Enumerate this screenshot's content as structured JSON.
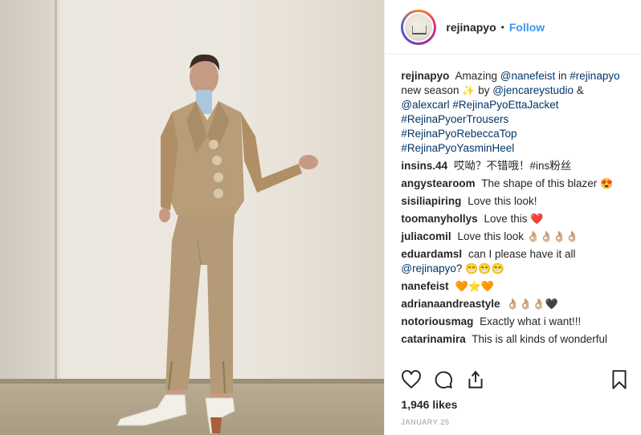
{
  "header": {
    "username": "rejinapyo",
    "separator": "•",
    "follow_label": "Follow"
  },
  "caption": {
    "username": "rejinapyo",
    "parts": [
      "Amazing",
      "@nanefeist",
      "in",
      "#rejinapyo",
      "new season",
      "✨",
      "by",
      "@jencareystudio",
      "&",
      "@alexcarl",
      "#RejinaPyoEttaJacket",
      "#RejinaPyoerTrousers",
      "#RejinaPyoRebeccaTop",
      "#RejinaPyoYasminHeel"
    ]
  },
  "comments": [
    {
      "user": "insins.44",
      "text": "哎呦？不错哦！#ins粉丝"
    },
    {
      "user": "angystearoom",
      "text": "The shape of this blazer",
      "emoji": "😍"
    },
    {
      "user": "sisiliapiring",
      "text": "Love this look!"
    },
    {
      "user": "toomanyhollys",
      "text": "Love this",
      "emoji": "❤️"
    },
    {
      "user": "juliacomil",
      "text": "Love this look",
      "emoji": "👌🏼👌🏼👌🏼👌🏼"
    },
    {
      "user": "eduardamsl",
      "text": "can I please have it all",
      "mention": "@rejinapyo",
      "tail": "?",
      "emoji": "😁😁😁"
    },
    {
      "user": "nanefeist",
      "text": "",
      "emoji": "🧡⭐🧡"
    },
    {
      "user": "adrianaandreastyle",
      "text": "",
      "emoji": "👌🏼👌🏼👌🏼🖤"
    },
    {
      "user": "notoriousmag",
      "text": "Exactly what i want!!!"
    },
    {
      "user": "catarinamira",
      "text": "This is all kinds of wonderful"
    }
  ],
  "actions": {
    "like_icon": "heart-icon",
    "comment_icon": "comment-icon",
    "share_icon": "share-icon",
    "save_icon": "bookmark-icon"
  },
  "likes_label": "1,946 likes",
  "date_label": "JANUARY 25",
  "colors": {
    "link": "#003569",
    "follow": "#3897f0",
    "text": "#262626",
    "muted": "#999999"
  }
}
